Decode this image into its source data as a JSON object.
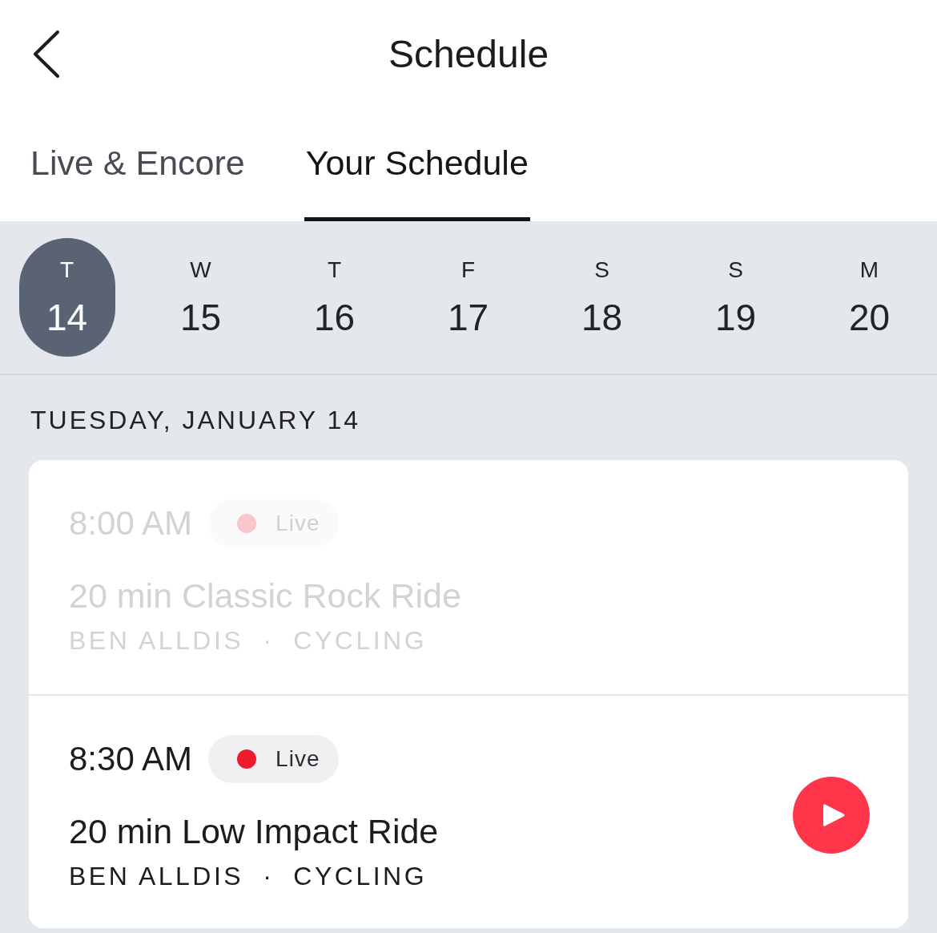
{
  "header": {
    "title": "Schedule"
  },
  "tabs": [
    {
      "label": "Live & Encore",
      "selected": false
    },
    {
      "label": "Your Schedule",
      "selected": true
    }
  ],
  "days": [
    {
      "weekday": "T",
      "date": "14",
      "selected": true
    },
    {
      "weekday": "W",
      "date": "15",
      "selected": false
    },
    {
      "weekday": "T",
      "date": "16",
      "selected": false
    },
    {
      "weekday": "F",
      "date": "17",
      "selected": false
    },
    {
      "weekday": "S",
      "date": "18",
      "selected": false
    },
    {
      "weekday": "S",
      "date": "19",
      "selected": false
    },
    {
      "weekday": "M",
      "date": "20",
      "selected": false
    }
  ],
  "date_heading": "TUESDAY, JANUARY 14",
  "classes": [
    {
      "time": "8:00 AM",
      "badge": "Live",
      "title": "20 min Classic Rock Ride",
      "instructor": "BEN ALLDIS",
      "separator": "·",
      "discipline": "CYCLING",
      "past": true,
      "playable": false
    },
    {
      "time": "8:30 AM",
      "badge": "Live",
      "title": "20 min Low Impact Ride",
      "instructor": "BEN ALLDIS",
      "separator": "·",
      "discipline": "CYCLING",
      "past": false,
      "playable": true
    }
  ]
}
